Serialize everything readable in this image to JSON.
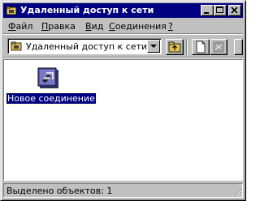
{
  "window": {
    "title": "Удаленный доступ к сети",
    "min_glyph": "_",
    "close_glyph": "×"
  },
  "menu": {
    "file": {
      "accel": "Ф",
      "rest": "айл"
    },
    "edit": {
      "accel": "П",
      "rest": "равка"
    },
    "view": {
      "accel": "В",
      "rest": "ид"
    },
    "connections": {
      "accel": "С",
      "rest": "оединения"
    },
    "help": {
      "accel": "?",
      "rest": ""
    }
  },
  "toolbar": {
    "address_value": "Удаленный доступ к сети",
    "icons": [
      "folder-icon",
      "up-folder-icon",
      "new-document-icon",
      "gray-connection-icon"
    ]
  },
  "content": {
    "items": [
      {
        "label": "Новое соединение",
        "icon": "new-connection-icon"
      }
    ]
  },
  "statusbar": {
    "text": "Выделено объектов: 1"
  },
  "colors": {
    "titlebar": "#000080",
    "face": "#c0c0c0",
    "selection": "#000080"
  }
}
